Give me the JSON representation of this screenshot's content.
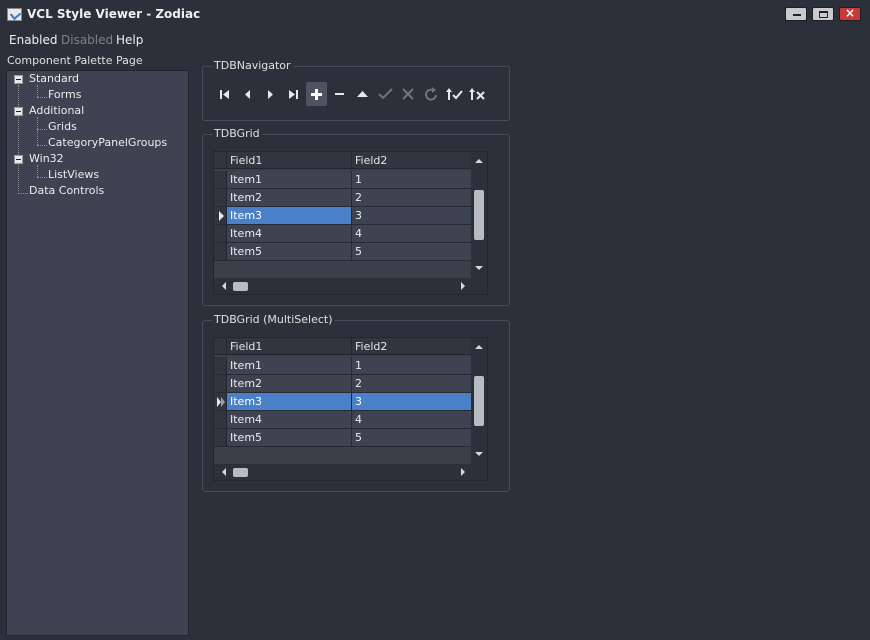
{
  "window": {
    "title": "VCL Style Viewer - Zodiac",
    "close_glyph": "×"
  },
  "menu": {
    "items": [
      {
        "label": "Enabled",
        "enabled": true
      },
      {
        "label": "Disabled",
        "enabled": false
      },
      {
        "label": "Help",
        "enabled": true
      }
    ]
  },
  "palette": {
    "caption": "Component Palette Page",
    "tree": [
      {
        "label": "Standard",
        "children": [
          "Forms"
        ]
      },
      {
        "label": "Additional",
        "children": [
          "Grids",
          "CategoryPanelGroups"
        ]
      },
      {
        "label": "Win32",
        "children": [
          "ListViews"
        ]
      },
      {
        "label": "Data Controls",
        "children": []
      }
    ]
  },
  "navigator": {
    "label": "TDBNavigator",
    "buttons": [
      {
        "name": "first-record-icon",
        "enabled": true
      },
      {
        "name": "prior-record-icon",
        "enabled": true
      },
      {
        "name": "next-record-icon",
        "enabled": true
      },
      {
        "name": "last-record-icon",
        "enabled": true
      },
      {
        "name": "insert-record-icon",
        "enabled": true
      },
      {
        "name": "delete-record-icon",
        "enabled": true
      },
      {
        "name": "edit-record-icon",
        "enabled": true
      },
      {
        "name": "post-edit-icon",
        "enabled": false
      },
      {
        "name": "cancel-edit-icon",
        "enabled": false
      },
      {
        "name": "refresh-data-icon",
        "enabled": false
      },
      {
        "name": "apply-updates-icon",
        "enabled": true
      },
      {
        "name": "cancel-updates-icon",
        "enabled": true
      }
    ]
  },
  "grid1": {
    "label": "TDBGrid",
    "columns": [
      "Field1",
      "Field2"
    ],
    "rows": [
      [
        "Item1",
        "1"
      ],
      [
        "Item2",
        "2"
      ],
      [
        "Item3",
        "3"
      ],
      [
        "Item4",
        "4"
      ],
      [
        "Item5",
        "5"
      ]
    ],
    "selected_row": 2
  },
  "grid2": {
    "label": "TDBGrid (MultiSelect)",
    "columns": [
      "Field1",
      "Field2"
    ],
    "rows": [
      [
        "Item1",
        "1"
      ],
      [
        "Item2",
        "2"
      ],
      [
        "Item3",
        "3"
      ],
      [
        "Item4",
        "4"
      ],
      [
        "Item5",
        "5"
      ]
    ],
    "selected_row": 2
  },
  "colors": {
    "background": "#2b303a",
    "panel": "#3d4350",
    "selection": "#4a80c8",
    "close_button": "#c83a3a"
  }
}
